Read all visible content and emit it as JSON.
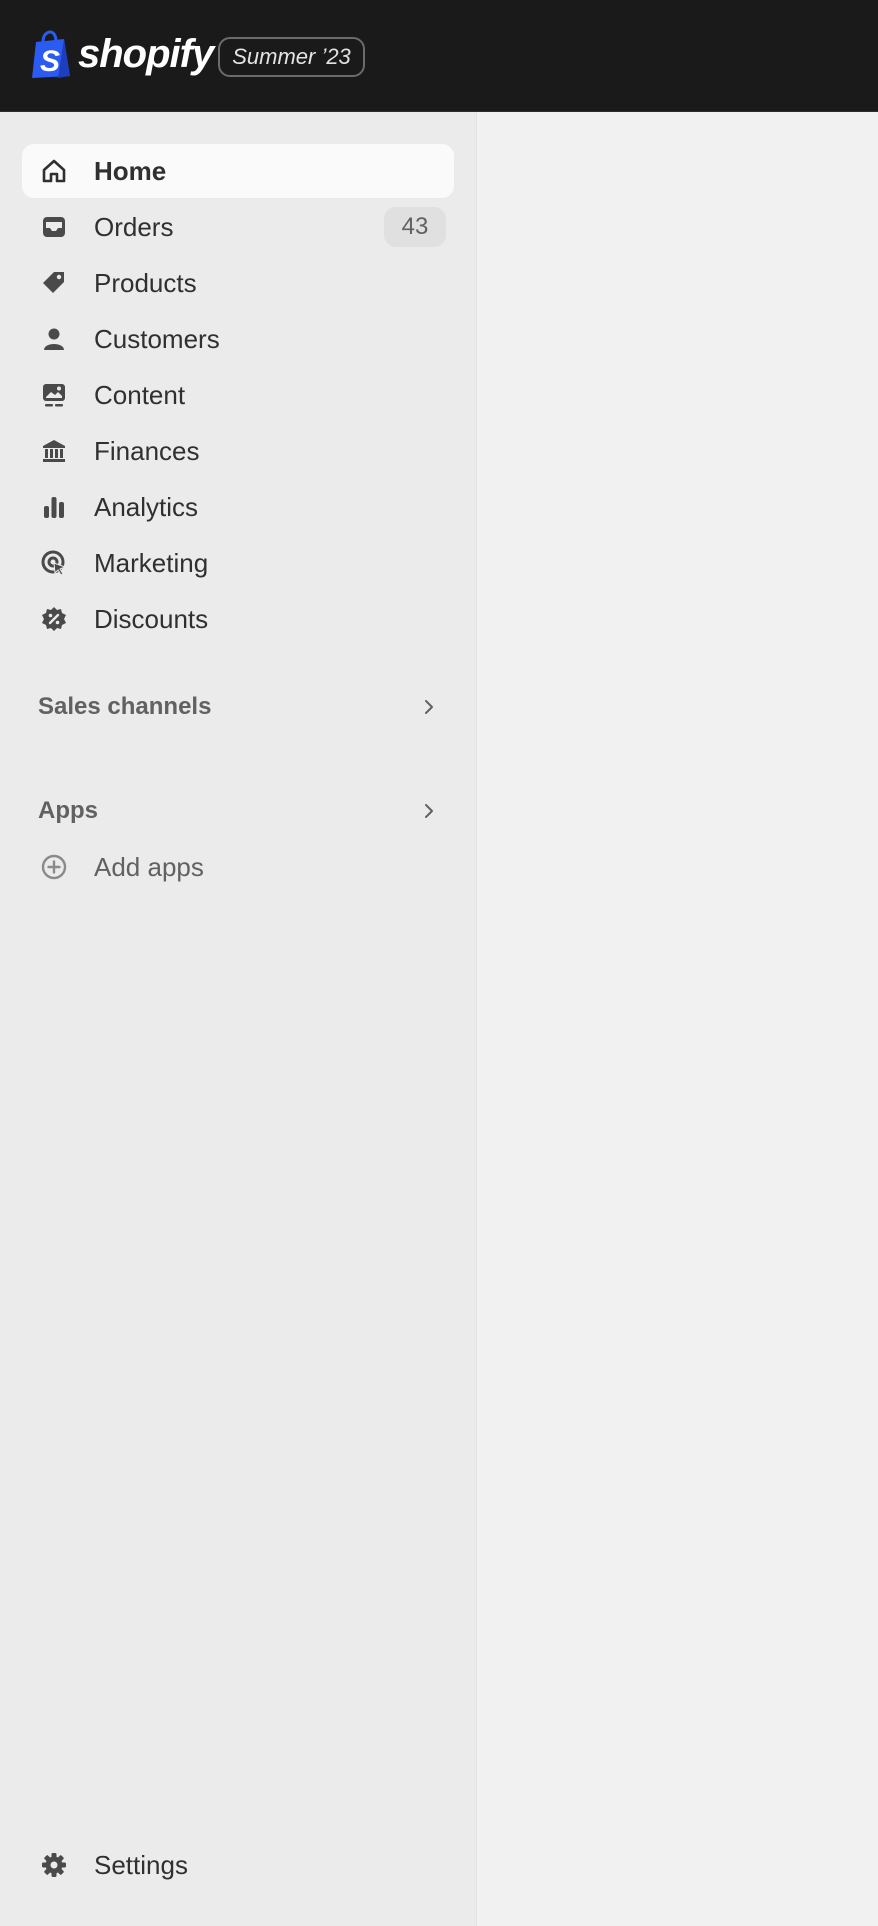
{
  "topbar": {
    "brand": "shopify",
    "release_badge": "Summer ’23"
  },
  "sidebar": {
    "nav": [
      {
        "label": "Home",
        "icon": "home-icon",
        "active": true
      },
      {
        "label": "Orders",
        "icon": "inbox-icon",
        "badge": "43"
      },
      {
        "label": "Products",
        "icon": "tag-icon"
      },
      {
        "label": "Customers",
        "icon": "person-icon"
      },
      {
        "label": "Content",
        "icon": "image-icon"
      },
      {
        "label": "Finances",
        "icon": "bank-icon"
      },
      {
        "label": "Analytics",
        "icon": "bar-chart-icon"
      },
      {
        "label": "Marketing",
        "icon": "target-icon"
      },
      {
        "label": "Discounts",
        "icon": "discount-icon"
      }
    ],
    "sales_channels": {
      "label": "Sales channels"
    },
    "apps": {
      "label": "Apps",
      "add_apps": "Add apps"
    },
    "settings": {
      "label": "Settings"
    }
  },
  "colors": {
    "topbar_bg": "#1a1a1a",
    "sidebar_bg": "#ebebeb",
    "main_bg": "#f1f1f1",
    "logo_green": "#2b5bf0"
  }
}
